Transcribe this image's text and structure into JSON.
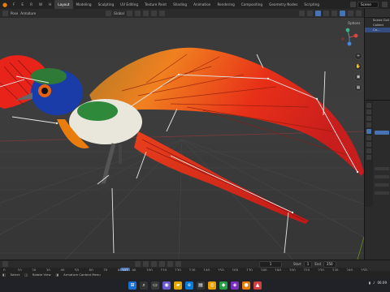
{
  "app": {
    "workspaces": [
      "Layout",
      "Modeling",
      "Sculpting",
      "UV Editing",
      "Texture Paint",
      "Shading",
      "Animation",
      "Rendering",
      "Compositing",
      "Geometry Nodes",
      "Scripting"
    ],
    "active_workspace": "Layout",
    "scene_name": "Scene"
  },
  "viewport_header": {
    "mode": "Pose",
    "menu_object": "Armature",
    "transform_orientation": "Global",
    "options_label": "Options"
  },
  "outliner": {
    "rows": [
      "Scene Coll",
      "Collect",
      "Ca..."
    ]
  },
  "timeline": {
    "start_label": "Start",
    "start_value": "1",
    "end_label": "End",
    "end_value": "250",
    "current_frame": "1",
    "current_frame_badge": "107",
    "ticks": [
      "0",
      "10",
      "20",
      "30",
      "40",
      "50",
      "60",
      "70",
      "80",
      "90",
      "100",
      "110",
      "120",
      "130",
      "140",
      "150",
      "160",
      "170",
      "180",
      "190",
      "200",
      "210",
      "220",
      "230",
      "240",
      "250"
    ]
  },
  "statusbar": {
    "items": [
      "Select",
      "Rotate View",
      "Armature Context Menu"
    ]
  },
  "taskbar": {
    "clock": "06:09"
  },
  "colors": {
    "accent": "#4772b3",
    "orange": "#e87d0d",
    "wing_red": "#e8241a",
    "wing_orange": "#f5a623"
  }
}
